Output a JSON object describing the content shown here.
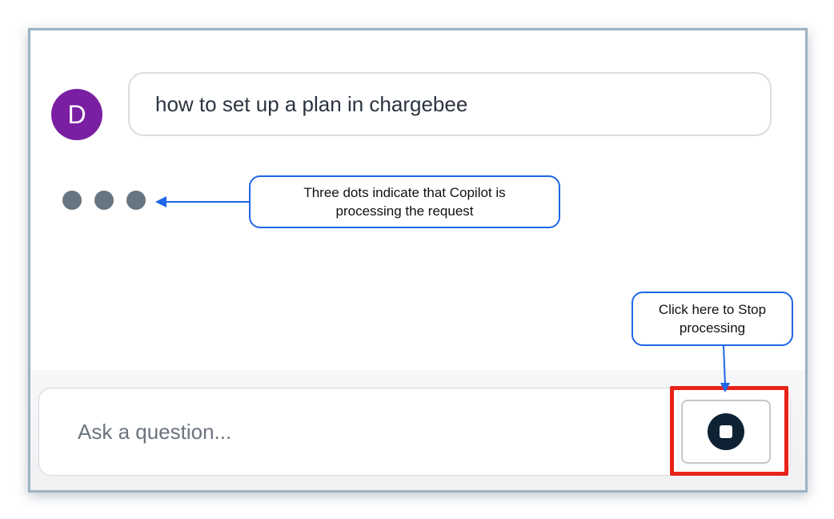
{
  "chat": {
    "user_initial": "D",
    "user_message": "how to set up a plan in chargebee"
  },
  "annotations": {
    "processing_note": "Three dots indicate that Copilot is\nprocessing the request",
    "stop_note": "Click here to Stop\nprocessing"
  },
  "composer": {
    "placeholder": "Ask a question..."
  },
  "colors": {
    "avatar": "#7a1fa2",
    "callout_border": "#1e66e6",
    "highlight": "#e8231a",
    "stop_button": "#0e2233"
  }
}
